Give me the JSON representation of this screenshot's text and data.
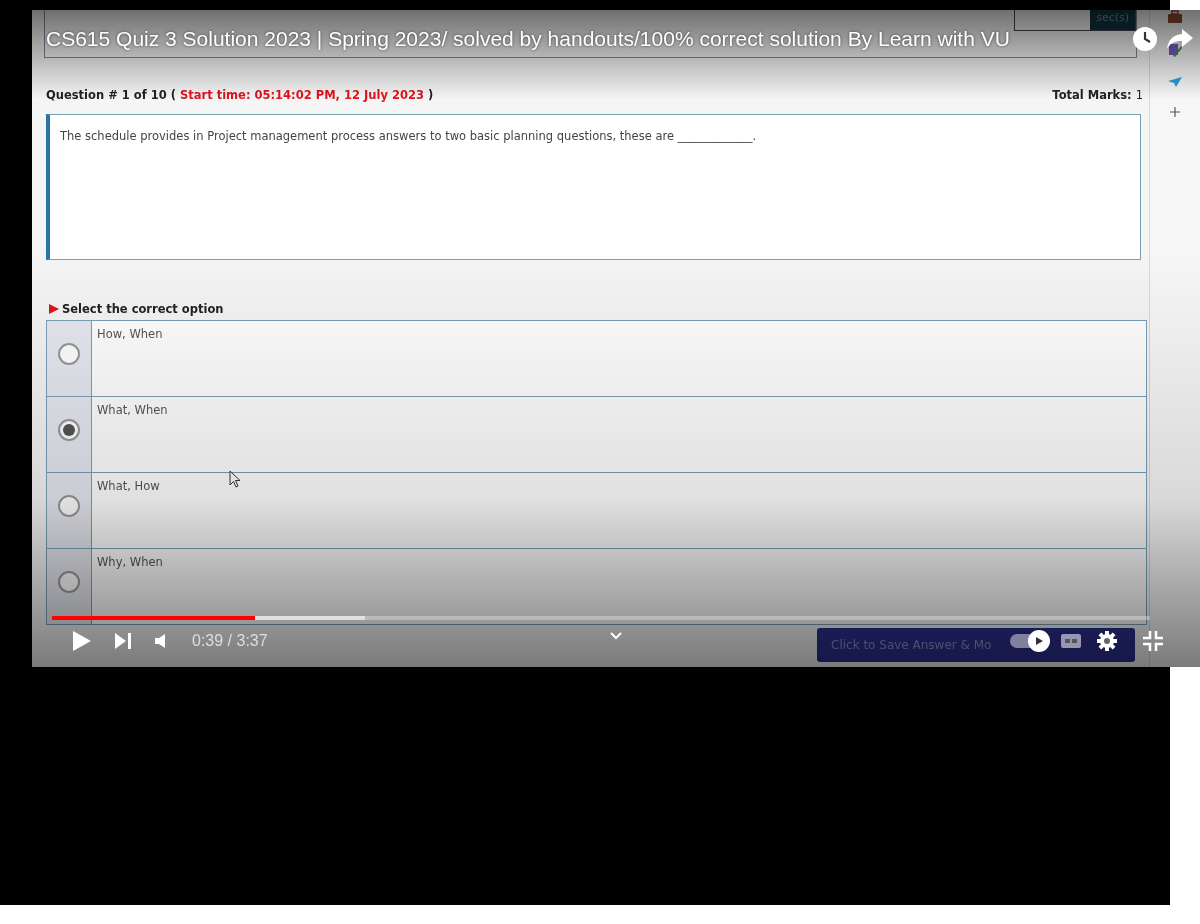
{
  "title": "CS615 Quiz 3 Solution 2023 | Spring 2023/ solved by handouts/100% correct solution By Learn with VU",
  "timer_unit": "sec(s)",
  "question": {
    "number": "Question # 1 of 10",
    "open": "(",
    "start_time": "Start time: 05:14:02 PM, 12 July 2023",
    "close": ")",
    "total_marks_label": "Total Marks:",
    "total_marks": "1",
    "text": "The schedule provides in Project management process answers to two basic planning questions, these are _____________."
  },
  "prompt": "Select the correct option",
  "options": [
    {
      "label": "How, When",
      "selected": false
    },
    {
      "label": "What, When",
      "selected": true
    },
    {
      "label": "What, How",
      "selected": false
    },
    {
      "label": "Why, When",
      "selected": false
    }
  ],
  "save_button": "Click to Save Answer & Mo",
  "player": {
    "progress": {
      "level": 0.185
    },
    "buffered": {
      "level": 0.285
    },
    "autoplay": {
      "on": true
    },
    "time": "0:39 / 3:37"
  }
}
